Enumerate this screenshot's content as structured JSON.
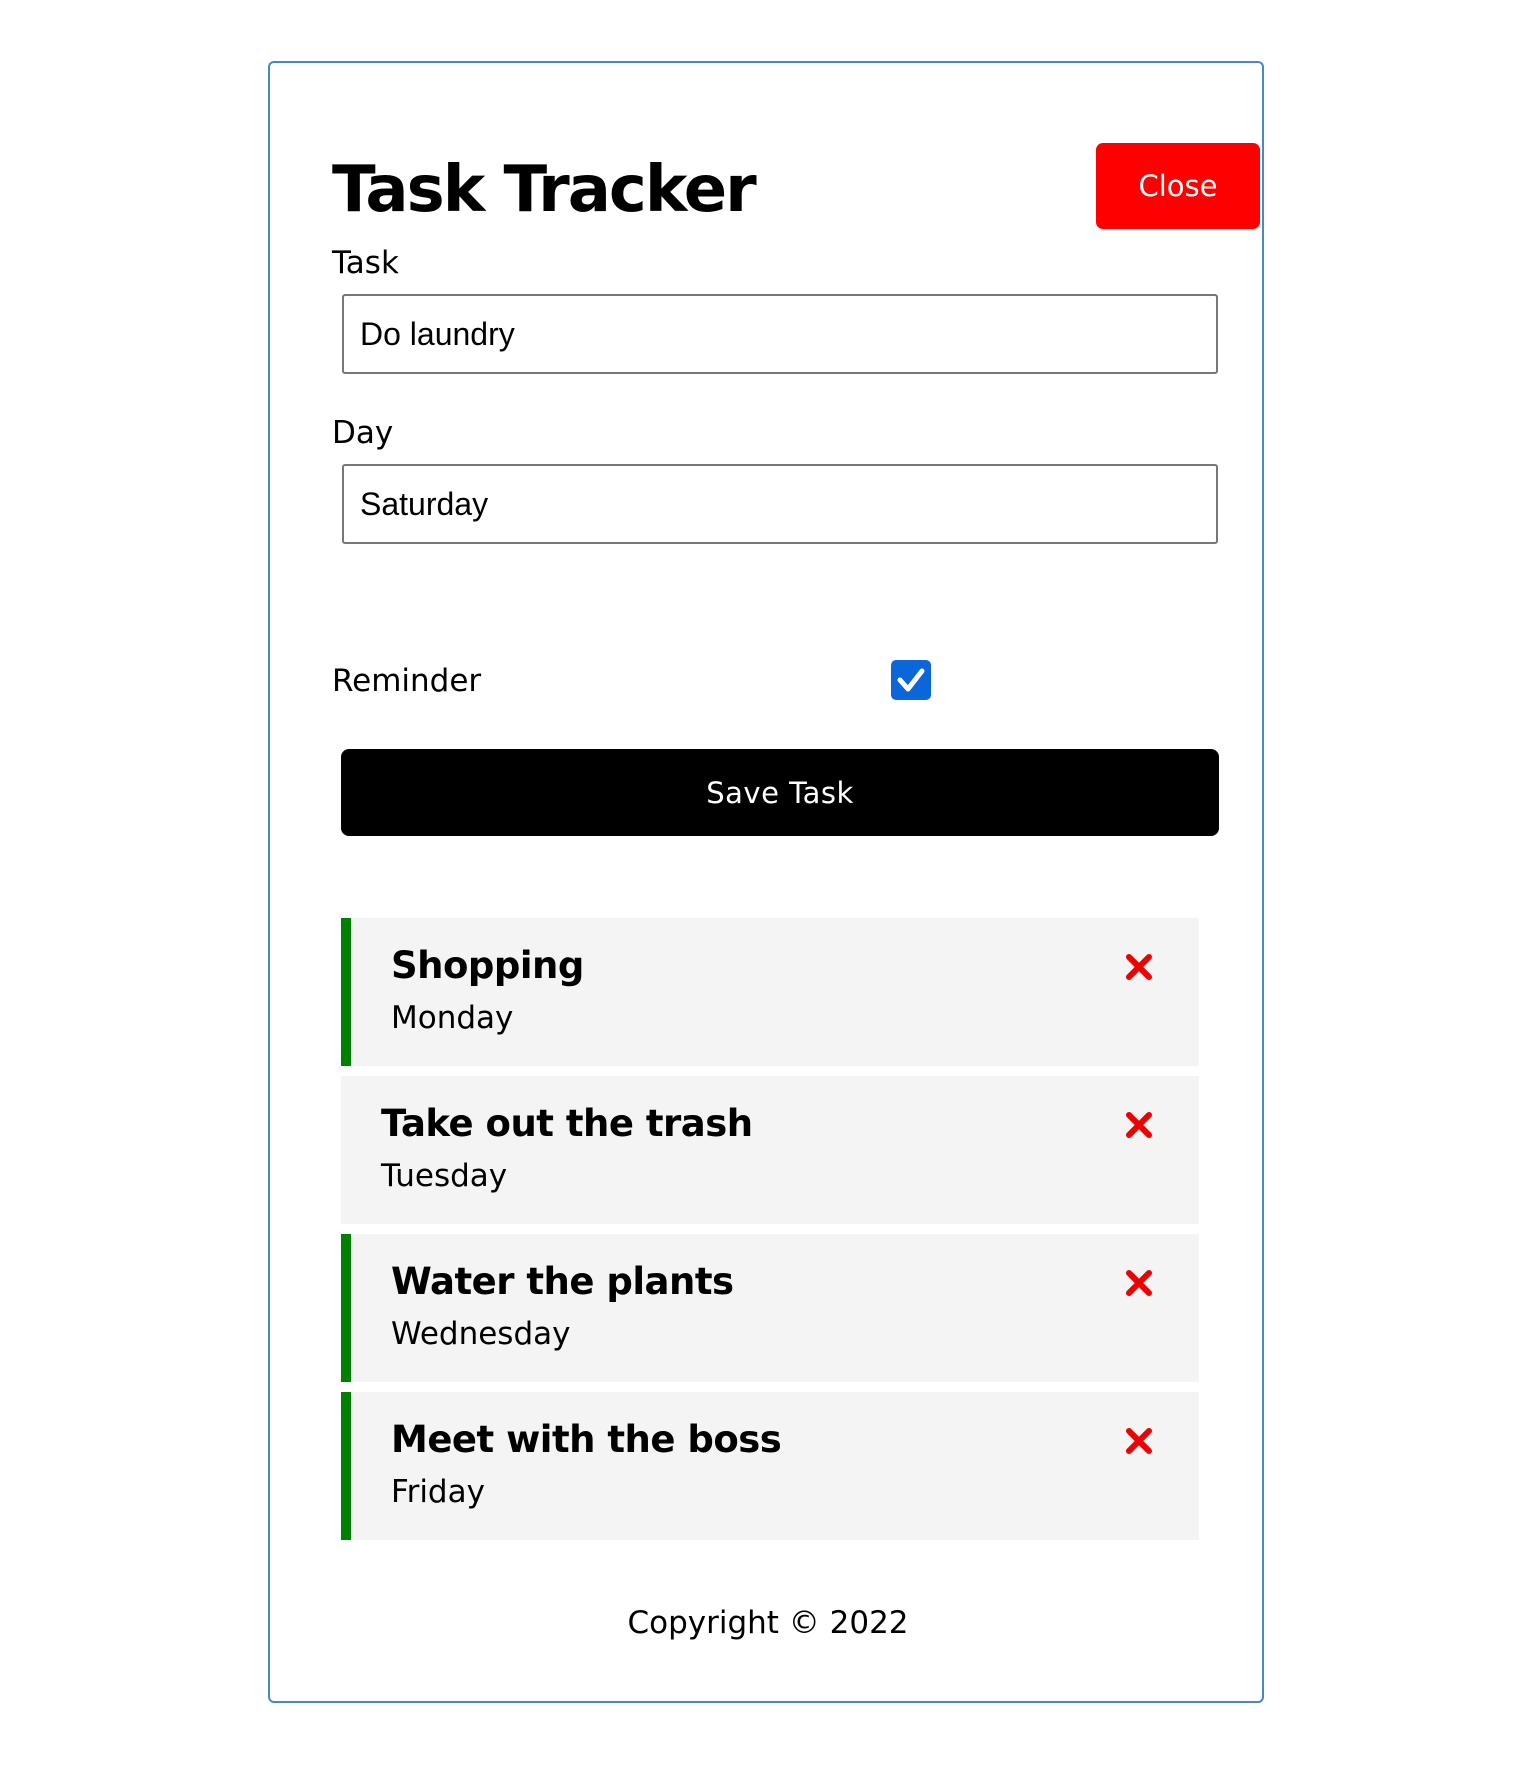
{
  "header": {
    "title": "Task Tracker",
    "toggle_label": "Close"
  },
  "form": {
    "task_label": "Task",
    "task_value": "Do laundry",
    "day_label": "Day",
    "day_value": "Saturday",
    "reminder_label": "Reminder",
    "reminder_checked": true,
    "submit_label": "Save Task"
  },
  "tasks": [
    {
      "text": "Shopping",
      "day": "Monday",
      "reminder": true
    },
    {
      "text": "Take out the trash",
      "day": "Tuesday",
      "reminder": false
    },
    {
      "text": "Water the plants",
      "day": "Wednesday",
      "reminder": true
    },
    {
      "text": "Meet with the boss",
      "day": "Friday",
      "reminder": true
    }
  ],
  "footer": {
    "copyright": "Copyright © 2022"
  },
  "colors": {
    "close_button": "#ff0000",
    "reminder_border": "#008000",
    "delete_icon": "#ee0000",
    "checkbox": "#0a66d9",
    "task_background": "#f4f4f4"
  },
  "icons": {
    "delete": "times-icon",
    "checkbox_mark": "check-icon"
  }
}
